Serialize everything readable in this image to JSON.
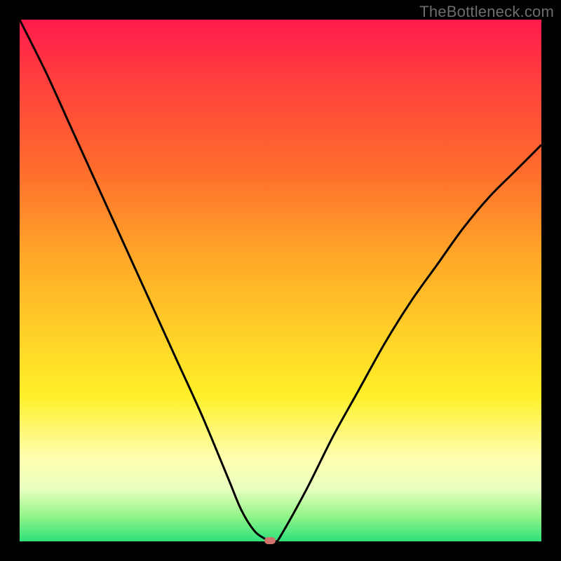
{
  "watermark": "TheBottleneck.com",
  "chart_data": {
    "type": "line",
    "title": "",
    "xlabel": "",
    "ylabel": "",
    "xlim": [
      0,
      100
    ],
    "ylim": [
      0,
      100
    ],
    "grid": false,
    "x": [
      0,
      5,
      10,
      15,
      20,
      25,
      30,
      35,
      40,
      42.5,
      45,
      47,
      48,
      49,
      50,
      55,
      60,
      65,
      70,
      75,
      80,
      85,
      90,
      95,
      100
    ],
    "y": [
      100,
      90,
      79,
      68,
      57,
      46,
      35,
      24,
      12,
      6,
      2,
      0.5,
      0,
      0,
      1,
      10,
      20,
      29,
      38,
      46,
      53,
      60,
      66,
      71,
      76
    ],
    "minimum_marker": {
      "x": 48,
      "y": 0
    },
    "background_gradient_stops": [
      {
        "pos": 0.0,
        "color": "#ff1a4d"
      },
      {
        "pos": 0.28,
        "color": "#ff6a2d"
      },
      {
        "pos": 0.6,
        "color": "#ffd028"
      },
      {
        "pos": 0.84,
        "color": "#ffffb0"
      },
      {
        "pos": 1.0,
        "color": "#2fe07a"
      }
    ]
  }
}
